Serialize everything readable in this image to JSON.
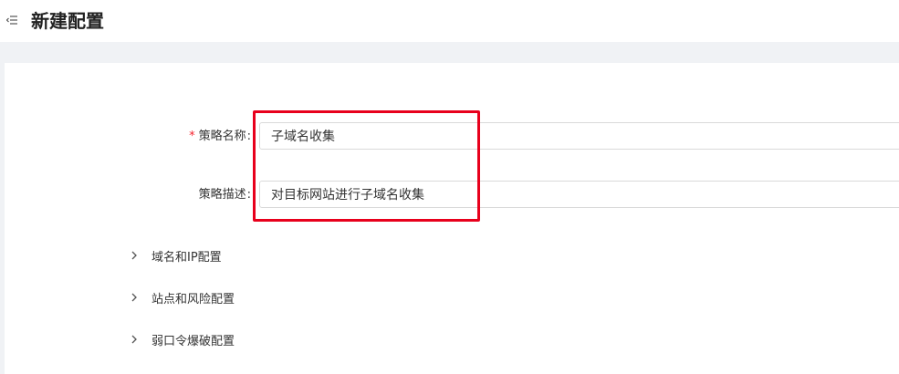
{
  "header": {
    "title": "新建配置",
    "menu_icon": "menu-fold-icon"
  },
  "form": {
    "name_field": {
      "required_mark": "*",
      "label": "策略名称",
      "value": "子域名收集"
    },
    "desc_field": {
      "label": "策略描述",
      "value": "对目标网站进行子域名收集"
    }
  },
  "sections": [
    {
      "label": "域名和IP配置",
      "icon": "chevron-right-icon"
    },
    {
      "label": "站点和风险配置",
      "icon": "chevron-right-icon"
    },
    {
      "label": "弱口令爆破配置",
      "icon": "chevron-right-icon"
    }
  ],
  "colors": {
    "highlight": "#e8001c",
    "background_band": "#f0f2f5",
    "required": "#f5222d"
  }
}
